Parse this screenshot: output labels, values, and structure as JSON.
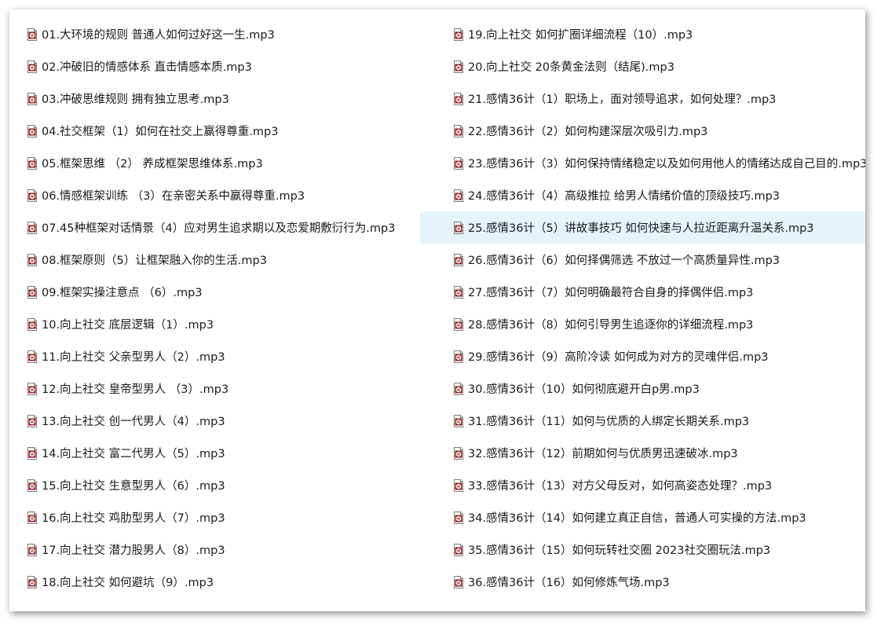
{
  "file_icon": "audio-file-icon",
  "selected_color": "#e5f3fb",
  "files_left": [
    "01.大环境的规则 普通人如何过好这一生.mp3",
    "02.冲破旧的情感体系 直击情感本质.mp3",
    "03.冲破思维规则 拥有独立思考.mp3",
    "04.社交框架（1）如何在社交上赢得尊重.mp3",
    "05.框架思维 （2） 养成框架思维体系.mp3",
    "06.情感框架训练 （3）在亲密关系中赢得尊重.mp3",
    "07.45种框架对话情景（4）应对男生追求期以及恋爱期敷衍行为.mp3",
    "08.框架原则（5）让框架融入你的生活.mp3",
    "09.框架实操注意点 （6）.mp3",
    "10.向上社交 底层逻辑（1）.mp3",
    "11.向上社交 父亲型男人（2）.mp3",
    "12.向上社交 皇帝型男人 （3）.mp3",
    "13.向上社交 创一代男人（4）.mp3",
    "14.向上社交 富二代男人（5）.mp3",
    "15.向上社交 生意型男人（6）.mp3",
    "16.向上社交 鸡肋型男人（7）.mp3",
    "17.向上社交 潜力股男人（8）.mp3",
    "18.向上社交 如何避坑（9）.mp3"
  ],
  "files_right": [
    "19.向上社交 如何扩圈详细流程（10）.mp3",
    "20.向上社交 20条黄金法则（结尾).mp3",
    "21.感情36计（1）职场上，面对领导追求，如何处理？.mp3",
    "22.感情36计（2）如何构建深层次吸引力.mp3",
    "23.感情36计（3）如何保持情绪稳定以及如何用他人的情绪达成自己目的.mp3",
    "24.感情36计（4）高级推拉 给男人情绪价值的顶级技巧.mp3",
    "25.感情36计（5）讲故事技巧 如何快速与人拉近距离升温关系.mp3",
    "26.感情36计（6）如何择偶筛选 不放过一个高质量异性.mp3",
    "27.感情36计（7）如何明确最符合自身的择偶伴侣.mp3",
    "28.感情36计（8）如何引导男生追逐你的详细流程.mp3",
    "29.感情36计（9）高阶冷读 如何成为对方的灵魂伴侣.mp3",
    "30.感情36计（10）如何彻底避开白p男.mp3",
    "31.感情36计（11）如何与优质的人绑定长期关系.mp3",
    "32.感情36计（12）前期如何与优质男迅速破冰.mp3",
    "33.感情36计（13）对方父母反对，如何高姿态处理？.mp3",
    "34.感情36计（14）如何建立真正自信，普通人可实操的方法.mp3",
    "35.感情36计（15）如何玩转社交圈 2023社交圈玩法.mp3",
    "36.感情36计（16）如何修炼气场.mp3"
  ],
  "selected_index_right": 6
}
